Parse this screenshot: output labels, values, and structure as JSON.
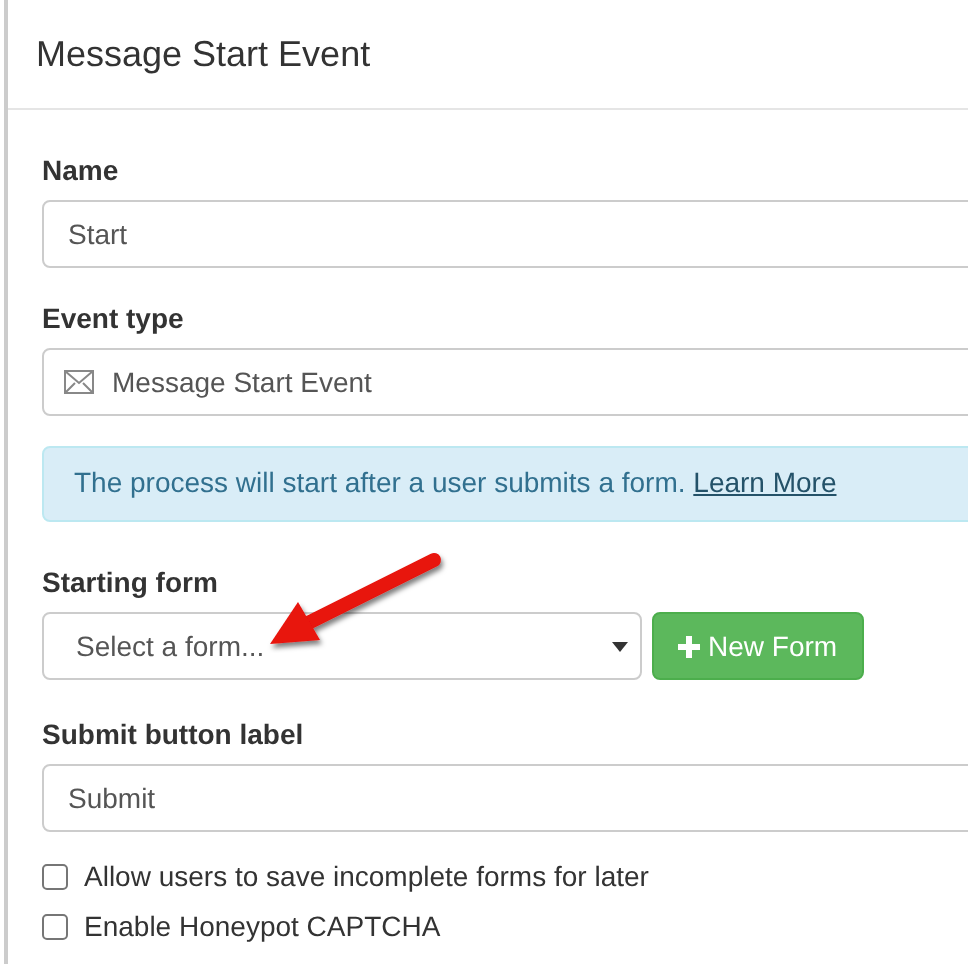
{
  "panel": {
    "title": "Message Start Event"
  },
  "fields": [
    {
      "kind": "text",
      "label": "Name",
      "value": "Start"
    },
    {
      "kind": "event-type",
      "label": "Event type",
      "value": "Message Start Event"
    }
  ],
  "info": {
    "text": "The process will start after a user submits a form.",
    "link": "Learn More"
  },
  "starting_form": {
    "label": "Starting form",
    "placeholder": "Select a form...",
    "button": "New Form"
  },
  "submit_field": {
    "label": "Submit button label",
    "value": "Submit"
  },
  "options": [
    {
      "label": "Allow users to save incomplete forms for later",
      "checked": false
    },
    {
      "label": "Enable Honeypot CAPTCHA",
      "checked": false
    }
  ]
}
